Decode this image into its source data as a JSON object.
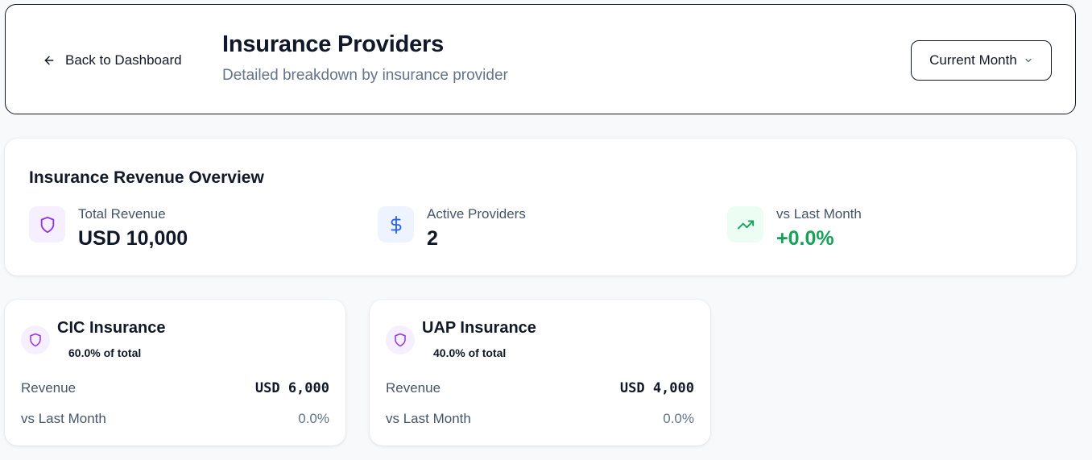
{
  "header": {
    "back_label": "Back to Dashboard",
    "title": "Insurance Providers",
    "subtitle": "Detailed breakdown by insurance provider",
    "period": "Current Month"
  },
  "overview": {
    "title": "Insurance Revenue Overview",
    "stats": [
      {
        "label": "Total Revenue",
        "value": "USD 10,000",
        "icon": "shield-icon",
        "icon_bg": "#f5efff",
        "icon_color": "#9333ea"
      },
      {
        "label": "Active Providers",
        "value": "2",
        "icon": "dollar-icon",
        "icon_bg": "#eef4ff",
        "icon_color": "#2563eb"
      },
      {
        "label": "vs Last Month",
        "value": "+0.0%",
        "icon": "trending-up-icon",
        "icon_bg": "#ecfdf3",
        "icon_color": "#16a05a"
      }
    ]
  },
  "providers": [
    {
      "name": "CIC Insurance",
      "share": "60.0% of total",
      "revenue_label": "Revenue",
      "revenue": "USD 6,000",
      "change_label": "vs Last Month",
      "change": "0.0%"
    },
    {
      "name": "UAP Insurance",
      "share": "40.0% of total",
      "revenue_label": "Revenue",
      "revenue": "USD 4,000",
      "change_label": "vs Last Month",
      "change": "0.0%"
    }
  ],
  "colors": {
    "accent_purple": "#9333ea",
    "accent_blue": "#2563eb",
    "accent_green": "#16a05a"
  }
}
